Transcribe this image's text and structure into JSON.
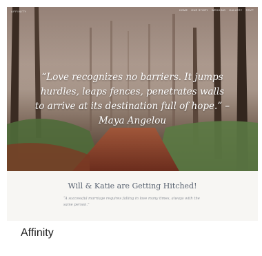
{
  "theme": {
    "name": "Affinity"
  },
  "preview": {
    "site_logo": "AFFINITY",
    "nav": [
      "HOME",
      "OUR STORY",
      "WEDDING",
      "GALLERY",
      "RSVP"
    ],
    "hero_quote": "“Love recognizes no barriers. It jumps hurdles, leaps fences, penetrates walls to arrive at its destination full of hope.” – Maya Angelou",
    "couple_title": "Will & Katie are Getting Hitched!",
    "sub_quote": "“A successful marriage requires falling in love many times, always with the same person.”"
  },
  "colors": {
    "title_text": "#5a6472",
    "subquote_text": "#8a8f97",
    "theme_name_text": "#1d1d1d"
  }
}
